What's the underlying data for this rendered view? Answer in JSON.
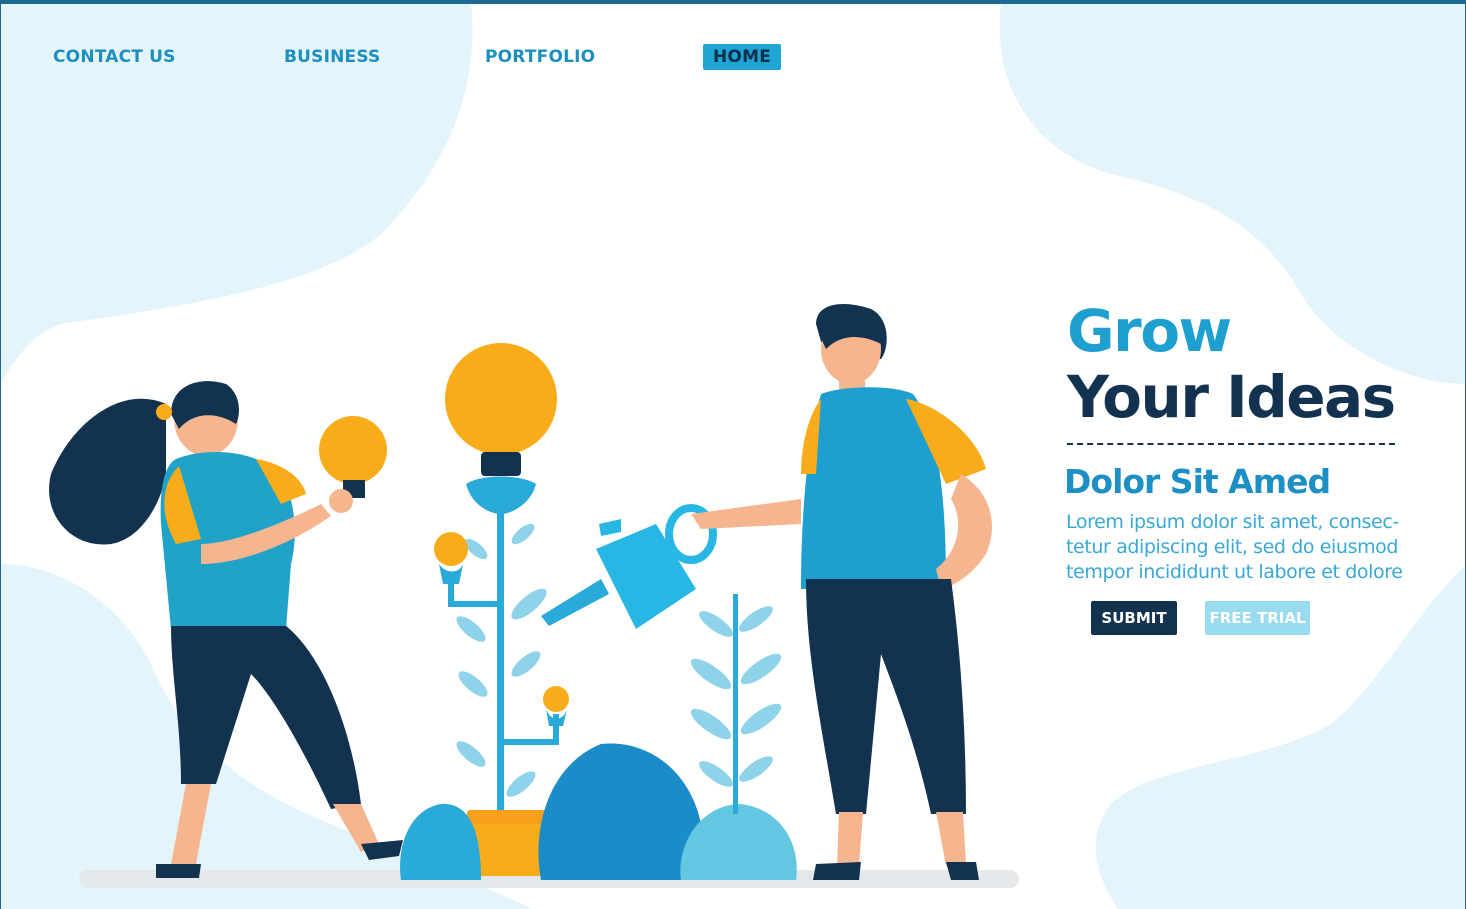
{
  "nav": {
    "items": [
      "CONTACT US",
      "BUSINESS",
      "PORTFOLIO",
      "HOME"
    ],
    "active": "HOME"
  },
  "hero": {
    "title_line1": "Grow",
    "title_line2": "Your Ideas",
    "subtitle": "Dolor Sit Amed",
    "body": "Lorem ipsum dolor sit amet, consec-tetur adipiscing elit, sed do eiusmod tempor incididunt ut labore et dolore",
    "submit_label": "SUBMIT",
    "trial_label": "FREE TRIAL"
  },
  "colors": {
    "brand_blue": "#1e9fcf",
    "navy": "#12324f",
    "light_blue": "#9adcef",
    "accent_yellow": "#f9ac1a"
  },
  "icons": [
    "lightbulb-icon",
    "watering-can-icon",
    "plant-icon"
  ]
}
